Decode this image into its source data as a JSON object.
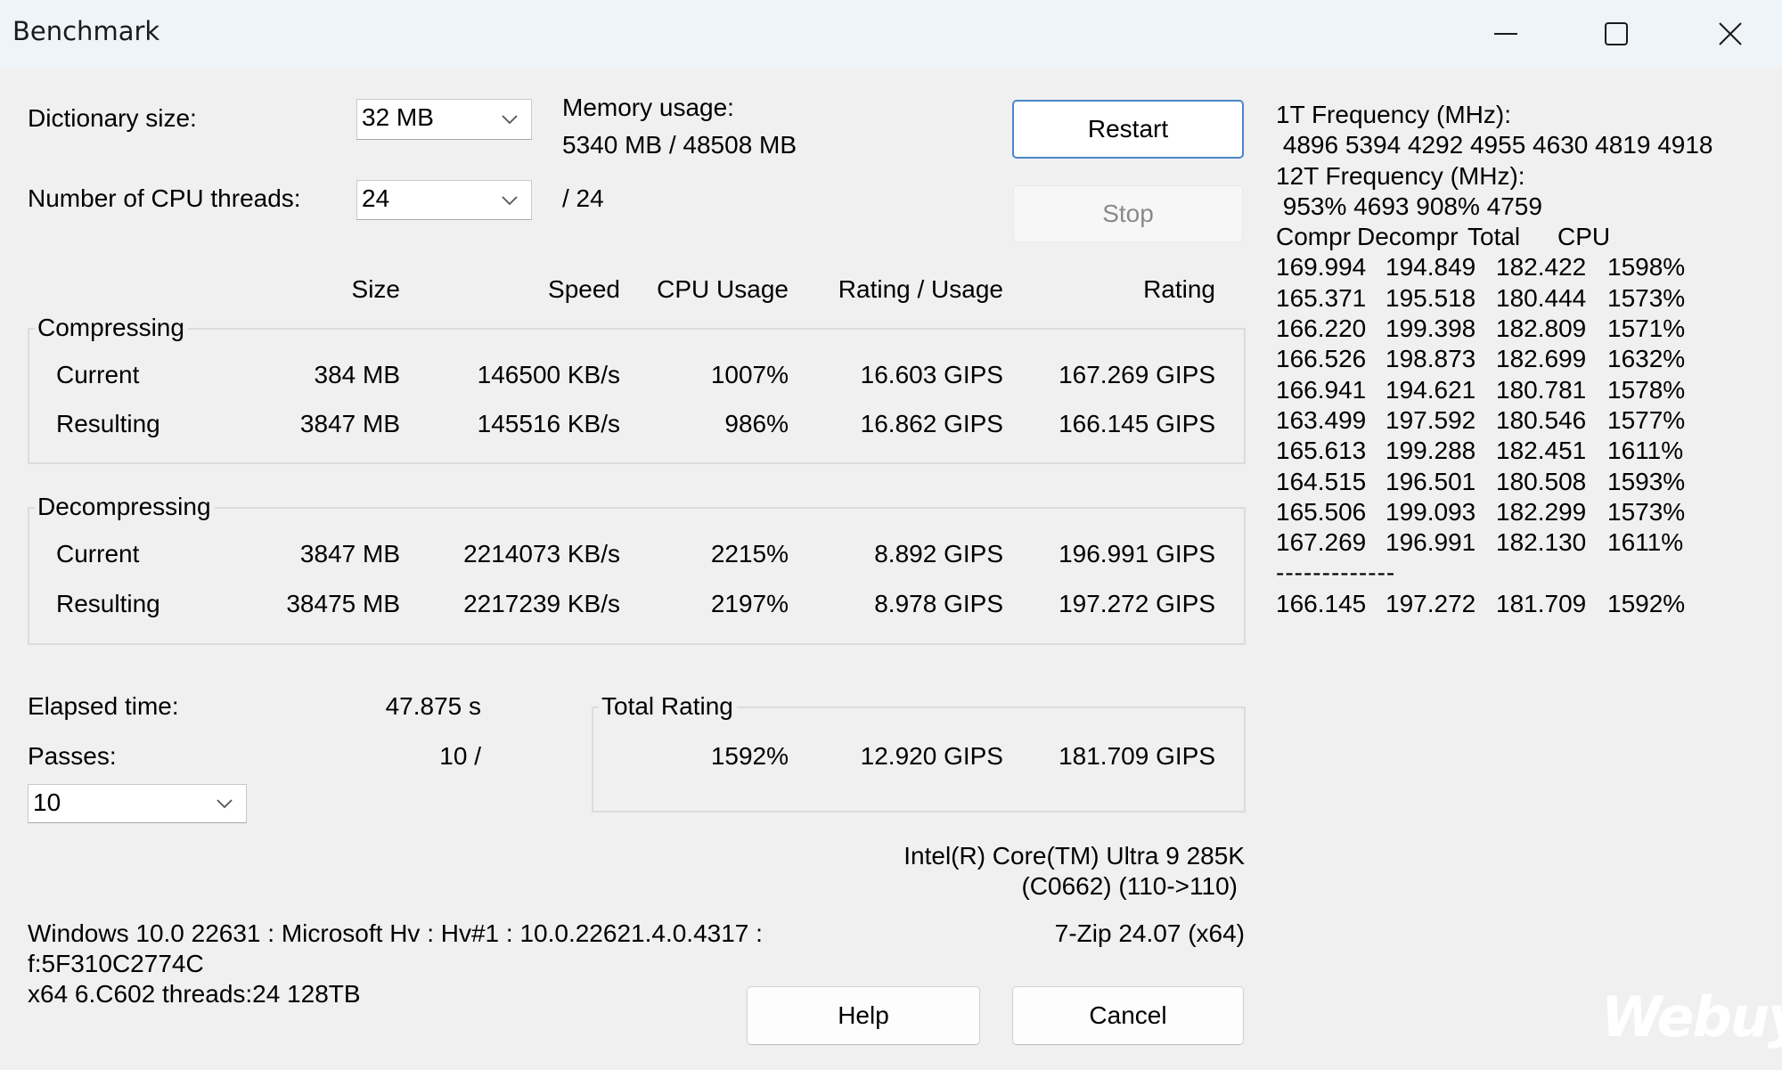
{
  "window": {
    "title": "Benchmark",
    "controls": {
      "minimize": "minimize-icon",
      "maximize": "maximize-icon",
      "close": "close-icon"
    }
  },
  "settings": {
    "dictionary_label": "Dictionary size:",
    "dictionary_value": "32 MB",
    "threads_label": "Number of CPU threads:",
    "threads_value": "24",
    "threads_max": "/ 24",
    "memory_label": "Memory usage:",
    "memory_value": "5340 MB / 48508 MB"
  },
  "buttons": {
    "restart": "Restart",
    "stop": "Stop",
    "help": "Help",
    "cancel": "Cancel"
  },
  "table": {
    "headers": [
      "Size",
      "Speed",
      "CPU Usage",
      "Rating / Usage",
      "Rating"
    ],
    "compressing": {
      "title": "Compressing",
      "rows": [
        {
          "label": "Current",
          "size": "384 MB",
          "speed": "146500 KB/s",
          "cpu": "1007%",
          "rating_usage": "16.603 GIPS",
          "rating": "167.269 GIPS"
        },
        {
          "label": "Resulting",
          "size": "3847 MB",
          "speed": "145516 KB/s",
          "cpu": "986%",
          "rating_usage": "16.862 GIPS",
          "rating": "166.145 GIPS"
        }
      ]
    },
    "decompressing": {
      "title": "Decompressing",
      "rows": [
        {
          "label": "Current",
          "size": "3847 MB",
          "speed": "2214073 KB/s",
          "cpu": "2215%",
          "rating_usage": "8.892 GIPS",
          "rating": "196.991 GIPS"
        },
        {
          "label": "Resulting",
          "size": "38475 MB",
          "speed": "2217239 KB/s",
          "cpu": "2197%",
          "rating_usage": "8.978 GIPS",
          "rating": "197.272 GIPS"
        }
      ]
    }
  },
  "stats": {
    "elapsed_label": "Elapsed time:",
    "elapsed_value": "47.875 s",
    "passes_label": "Passes:",
    "passes_value": "10 /",
    "passes_select": "10"
  },
  "total_rating": {
    "title": "Total Rating",
    "cpu": "1592%",
    "rating_usage": "12.920 GIPS",
    "rating": "181.709 GIPS"
  },
  "cpu_info": {
    "line1": "Intel(R) Core(TM) Ultra 9 285K",
    "line2": "(C0662) (110->110)",
    "version": "7-Zip 24.07 (x64)"
  },
  "system_info": {
    "line1": "Windows 10.0 22631 : Microsoft Hv : Hv#1 : 10.0.22621.4.0.4317 :",
    "line2": "f:5F310C2774C",
    "line3": "x64 6.C602 threads:24 128TB"
  },
  "log": {
    "freq1_label": "1T Frequency (MHz):",
    "freq1_values": " 4896 5394 4292 4955 4630 4819 4918",
    "freq12_label": "12T Frequency (MHz):",
    "freq12_values": " 953% 4693 908% 4759",
    "columns": [
      "Compr",
      "Decompr",
      "Total",
      "CPU"
    ],
    "passes": [
      [
        "169.994",
        "194.849",
        "182.422",
        "1598%"
      ],
      [
        "165.371",
        "195.518",
        "180.444",
        "1573%"
      ],
      [
        "166.220",
        "199.398",
        "182.809",
        "1571%"
      ],
      [
        "166.526",
        "198.873",
        "182.699",
        "1632%"
      ],
      [
        "166.941",
        "194.621",
        "180.781",
        "1578%"
      ],
      [
        "163.499",
        "197.592",
        "180.546",
        "1577%"
      ],
      [
        "165.613",
        "199.288",
        "182.451",
        "1611%"
      ],
      [
        "164.515",
        "196.501",
        "180.508",
        "1593%"
      ],
      [
        "165.506",
        "199.093",
        "182.299",
        "1573%"
      ],
      [
        "167.269",
        "196.991",
        "182.130",
        "1611%"
      ]
    ],
    "separator": "-------------",
    "average": [
      "166.145",
      "197.272",
      "181.709",
      "1592%"
    ]
  },
  "watermark": "Webuy",
  "colors": {
    "accent_border": "#4a86c8",
    "titlebar": "#eff4f9",
    "background": "#f0f0f0"
  }
}
